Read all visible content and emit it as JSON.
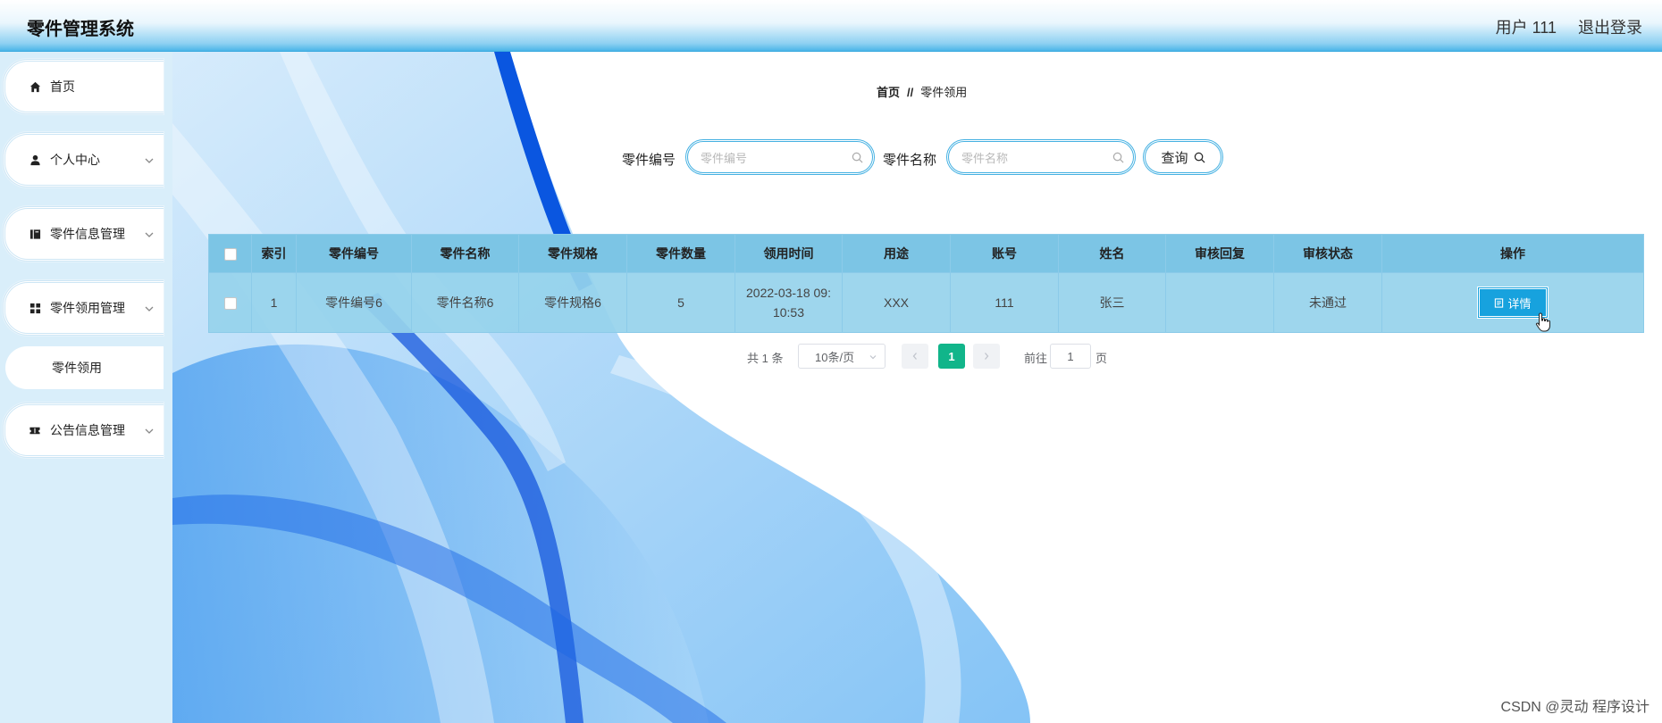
{
  "header": {
    "title": "零件管理系统",
    "user": "用户 111",
    "logout": "退出登录"
  },
  "sidebar": {
    "items": [
      {
        "label": "首页",
        "icon": "home-icon"
      },
      {
        "label": "个人中心",
        "icon": "user-icon"
      },
      {
        "label": "零件信息管理",
        "icon": "book-icon"
      },
      {
        "label": "零件领用管理",
        "icon": "grid-icon"
      },
      {
        "label": "公告信息管理",
        "icon": "ticket-icon"
      }
    ],
    "sub_item": "零件领用"
  },
  "breadcrumb": {
    "home": "首页",
    "sep": "//",
    "current": "零件领用"
  },
  "search": {
    "part_no_label": "零件编号",
    "part_no_placeholder": "零件编号",
    "part_name_label": "零件名称",
    "part_name_placeholder": "零件名称",
    "query_label": "查询"
  },
  "table": {
    "headers": [
      "索引",
      "零件编号",
      "零件名称",
      "零件规格",
      "零件数量",
      "领用时间",
      "用途",
      "账号",
      "姓名",
      "审核回复",
      "审核状态",
      "操作"
    ],
    "rows": [
      {
        "index": "1",
        "part_no": "零件编号6",
        "part_name": "零件名称6",
        "spec": "零件规格6",
        "qty": "5",
        "time_date": "2022-03-18 09:",
        "time_clock": "10:53",
        "usage": "XXX",
        "account": "111",
        "name": "张三",
        "reply": "",
        "status": "未通过",
        "action": "详情"
      }
    ]
  },
  "pagination": {
    "total": "共 1 条",
    "page_size": "10条/页",
    "current": "1",
    "goto": "前往",
    "goto_value": "1",
    "page_unit": "页"
  },
  "watermark": "CSDN @灵动 程序设计",
  "colors": {
    "accent": "#17a2de",
    "header_bg": "#7cc5e5",
    "row_bg": "#96d2eb",
    "page_active": "#11b58a"
  }
}
